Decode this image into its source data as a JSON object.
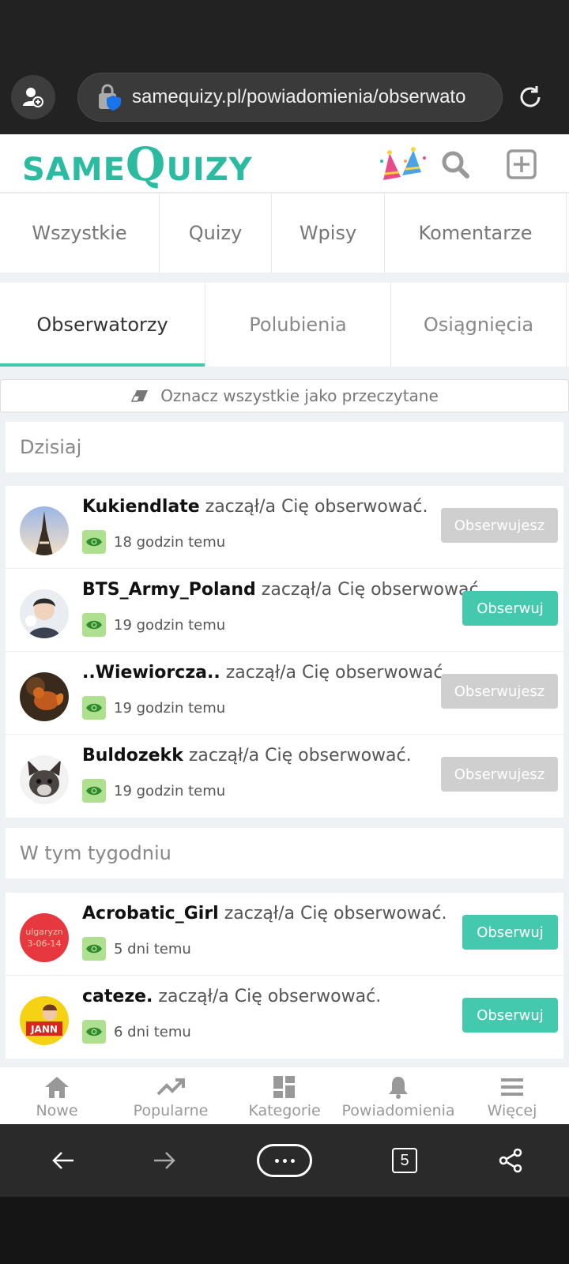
{
  "browser": {
    "url": "samequizy.pl/powiadomienia/obserwato",
    "open_tabs": "5"
  },
  "header": {
    "logo_small_1": "SAME",
    "logo_big": "Q",
    "logo_small_2": "UIZY"
  },
  "category_tabs": [
    "Wszystkie",
    "Quizy",
    "Wpisy",
    "Komentarze"
  ],
  "notification_tabs": [
    "Obserwatorzy",
    "Polubienia",
    "Osiągnięcia"
  ],
  "active_notification_tab": "Obserwatorzy",
  "mark_all_read": "Oznacz wszystkie jako przeczytane",
  "sections": {
    "today": {
      "title": "Dzisiaj",
      "items": [
        {
          "user": "Kukiendlate",
          "action": "zaczął/a Cię obserwować.",
          "time": "18 godzin temu",
          "button": "Obserwujesz",
          "following": true
        },
        {
          "user": "BTS_Army_Poland",
          "action": "zaczął/a Cię obserwować.",
          "time": "19 godzin temu",
          "button": "Obserwuj",
          "following": false
        },
        {
          "user": "..Wiewiorcza..",
          "action": "zaczął/a Cię obserwować.",
          "time": "19 godzin temu",
          "button": "Obserwujesz",
          "following": true
        },
        {
          "user": "Buldozekk",
          "action": "zaczął/a Cię obserwować.",
          "time": "19 godzin temu",
          "button": "Obserwujesz",
          "following": true
        }
      ]
    },
    "week": {
      "title": "W tym tygodniu",
      "items": [
        {
          "user": "Acrobatic_Girl",
          "action": "zaczął/a Cię obserwować.",
          "time": "5 dni temu",
          "button": "Obserwuj",
          "following": false
        },
        {
          "user": "cateze.",
          "action": "zaczął/a Cię obserwować.",
          "time": "6 dni temu",
          "button": "Obserwuj",
          "following": false
        }
      ]
    }
  },
  "avatar_texts": {
    "acrobatic_line1": "ulgaryzn",
    "acrobatic_line2": "3-06-14",
    "cateze": "JANN"
  },
  "bottom_nav": [
    "Nowe",
    "Popularne",
    "Kategorie",
    "Powiadomienia",
    "Więcej"
  ],
  "colors": {
    "brand": "#2bbba0",
    "follow_button": "#45c9ae",
    "following_button": "#cfcfcf",
    "eye_badge": "#aee08f"
  }
}
